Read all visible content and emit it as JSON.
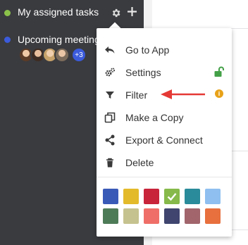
{
  "sidebar": {
    "items": [
      {
        "label": "My assigned tasks",
        "dot_color": "#8bc34a"
      },
      {
        "label": "Upcoming meetings",
        "dot_color": "#3b5bdb"
      }
    ],
    "avatar_more": "+3"
  },
  "menu": {
    "items": [
      {
        "label": "Go to App",
        "icon": "undo-arrow-icon"
      },
      {
        "label": "Settings",
        "icon": "gears-icon",
        "badge": "unlock-icon"
      },
      {
        "label": "Filter",
        "icon": "filter-icon",
        "badge": "info-icon"
      },
      {
        "label": "Make a Copy",
        "icon": "copy-icon"
      },
      {
        "label": "Export & Connect",
        "icon": "share-icon"
      },
      {
        "label": "Delete",
        "icon": "trash-icon"
      }
    ],
    "swatches": [
      "#3a5ab8",
      "#e3ba2a",
      "#c8243a",
      "#86b94a",
      "#2a8b9a",
      "#8fbff0",
      "#4e7b57",
      "#c6c28f",
      "#ef6f68",
      "#3f456e",
      "#a2656c",
      "#e7703e"
    ],
    "selected_swatch": "#86b94a"
  },
  "colors": {
    "sidebar_bg": "#3a3b3f",
    "arrow": "#e53935",
    "unlock": "#43a047",
    "info": "#e8a219"
  }
}
